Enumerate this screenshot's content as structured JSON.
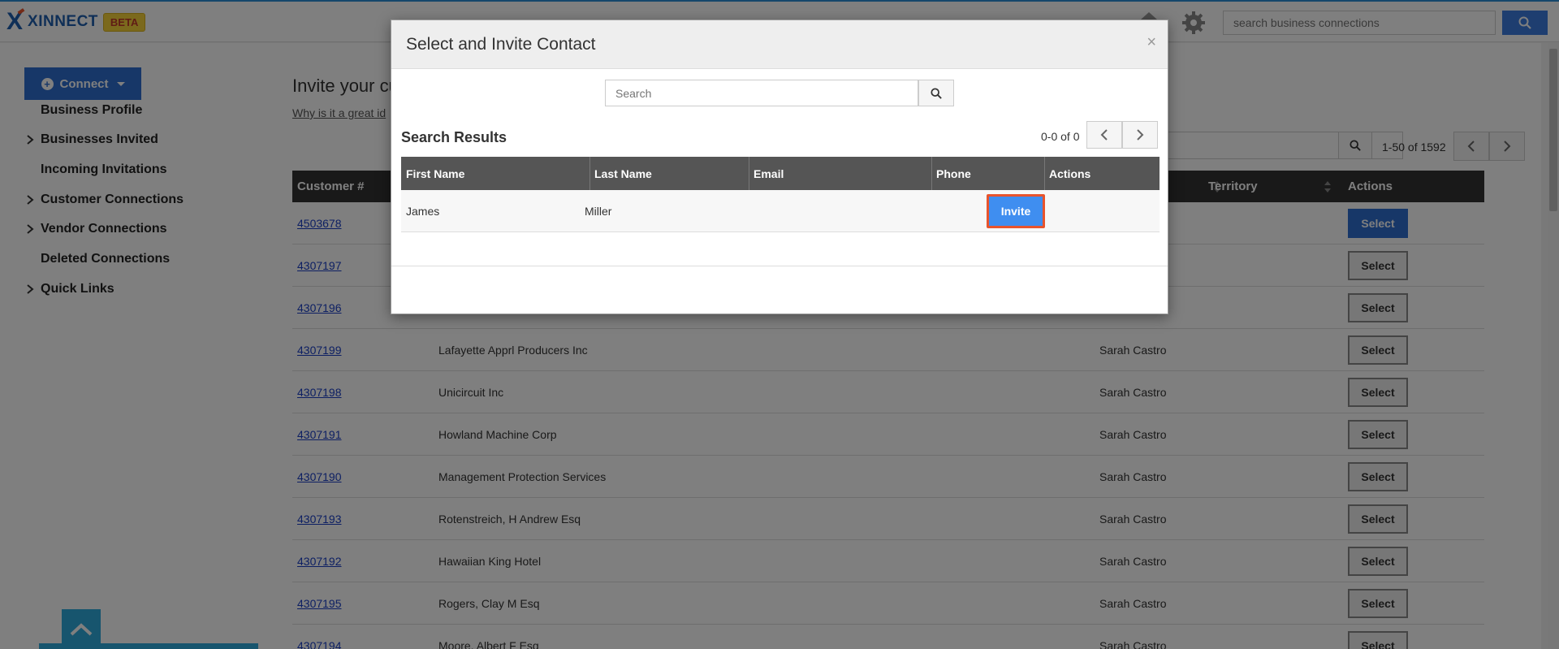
{
  "header": {
    "brand": "XINNECT",
    "beta": "BETA",
    "search_placeholder": "search business connections"
  },
  "sidebar": {
    "connect_label": "Connect",
    "items": [
      {
        "label": "Business Profile",
        "expandable": false
      },
      {
        "label": "Businesses Invited",
        "expandable": true
      },
      {
        "label": "Incoming Invitations",
        "expandable": false
      },
      {
        "label": "Customer Connections",
        "expandable": true
      },
      {
        "label": "Vendor Connections",
        "expandable": true
      },
      {
        "label": "Deleted Connections",
        "expandable": false
      },
      {
        "label": "Quick Links",
        "expandable": true
      }
    ]
  },
  "main": {
    "title": "Invite your cu",
    "link": "Why is it a great id",
    "filter_placeholder": "s",
    "page_count": "1-50 of 1592",
    "columns": {
      "customer": "Customer #",
      "territory": "Territory",
      "actions": "Actions"
    },
    "select_label": "Select",
    "rows": [
      {
        "customer": "4503678",
        "name": "",
        "rep": ""
      },
      {
        "customer": "4307197",
        "name": "",
        "rep": ""
      },
      {
        "customer": "4307196",
        "name": "",
        "rep": ""
      },
      {
        "customer": "4307199",
        "name": "Lafayette Apprl Producers Inc",
        "rep": "Sarah Castro"
      },
      {
        "customer": "4307198",
        "name": "Unicircuit Inc",
        "rep": "Sarah Castro"
      },
      {
        "customer": "4307191",
        "name": "Howland Machine Corp",
        "rep": "Sarah Castro"
      },
      {
        "customer": "4307190",
        "name": "Management Protection Services",
        "rep": "Sarah Castro"
      },
      {
        "customer": "4307193",
        "name": "Rotenstreich, H Andrew Esq",
        "rep": "Sarah Castro"
      },
      {
        "customer": "4307192",
        "name": "Hawaiian King Hotel",
        "rep": "Sarah Castro"
      },
      {
        "customer": "4307195",
        "name": "Rogers, Clay M Esq",
        "rep": "Sarah Castro"
      },
      {
        "customer": "4307194",
        "name": "Moore, Albert F Esq",
        "rep": "Sarah Castro"
      }
    ]
  },
  "modal": {
    "title": "Select and Invite Contact",
    "close": "×",
    "search_placeholder": "Search",
    "results_title": "Search Results",
    "count": "0-0 of 0",
    "columns": [
      "First Name",
      "Last Name",
      "Email",
      "Phone",
      "Actions"
    ],
    "row": {
      "first_name": "James",
      "last_name": "Miller",
      "email": "",
      "phone": ""
    },
    "invite_label": "Invite"
  }
}
